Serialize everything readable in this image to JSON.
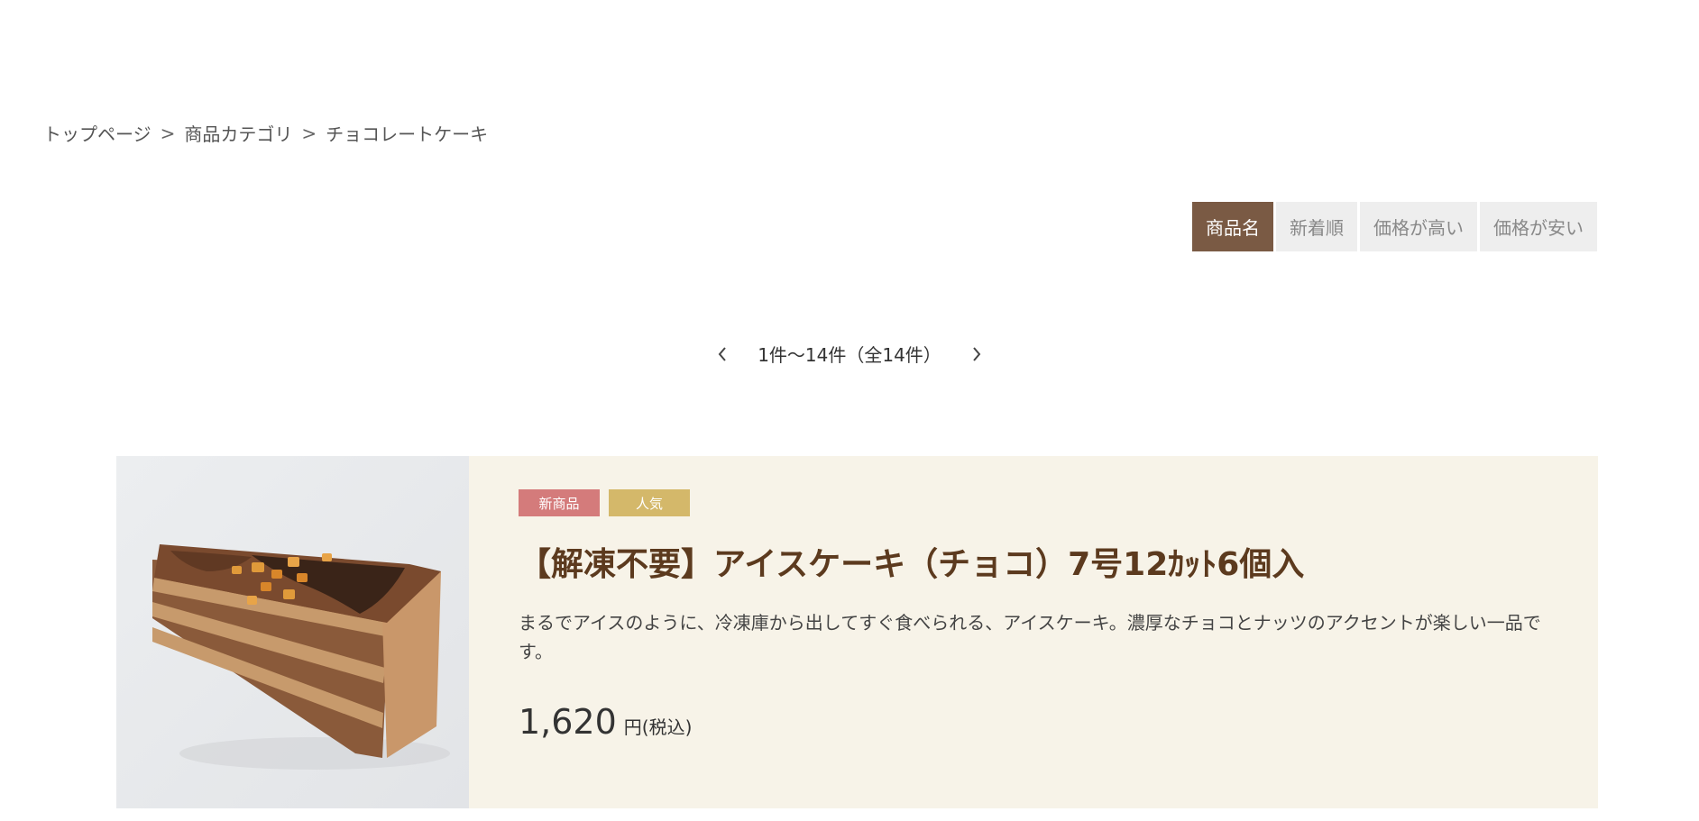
{
  "breadcrumb": {
    "items": [
      "トップページ",
      "商品カテゴリ",
      "チョコレートケーキ"
    ],
    "separator": ">"
  },
  "sort": {
    "options": [
      "商品名",
      "新着順",
      "価格が高い",
      "価格が安い"
    ],
    "active": "商品名"
  },
  "pager": {
    "summary": "1件〜14件（全14件）",
    "prev_icon": "chevron-left-icon",
    "next_icon": "chevron-right-icon"
  },
  "product": {
    "badges": [
      "新商品",
      "人気"
    ],
    "title": "【解凍不要】アイスケーキ（チョコ）7号12ｶｯﾄ6個入",
    "description": "まるでアイスのように、冷凍庫から出してすぐ食べられる、アイスケーキ。濃厚なチョコとナッツのアクセントが楽しい一品です。",
    "price": "1,620",
    "price_unit": "円(税込)"
  },
  "colors": {
    "sort_active_bg": "#7a5a44",
    "sort_inactive_bg": "#eeeeee",
    "card_bg": "#f7f3e8",
    "title_color": "#5c3a1e",
    "badge_new": "#d47b7b",
    "badge_popular": "#d4b86a"
  }
}
